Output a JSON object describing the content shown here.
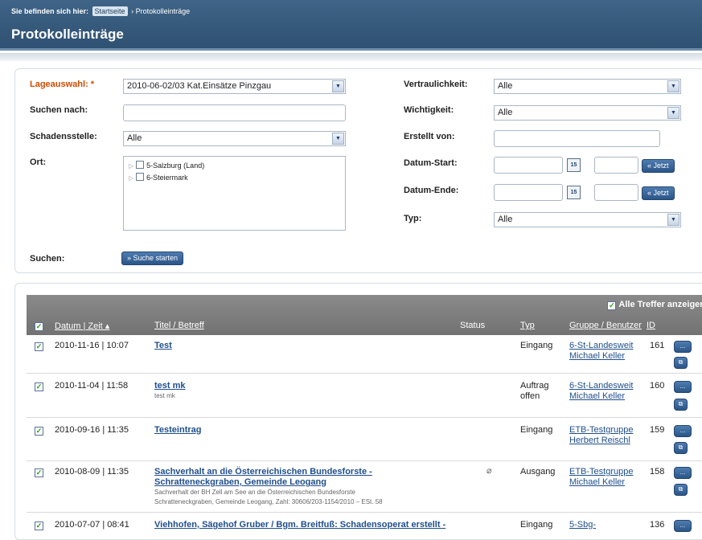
{
  "breadcrumb": {
    "label": "Sie befinden sich hier:",
    "home": "Startseite",
    "current": "› Protokolleinträge"
  },
  "page_title": "Protokolleinträge",
  "search": {
    "lageauswahl_label": "Lageauswahl: *",
    "lageauswahl_value": "2010-06-02/03 Kat.Einsätze Pinzgau",
    "suchen_nach_label": "Suchen nach:",
    "suchen_nach_value": "",
    "schadensstelle_label": "Schadensstelle:",
    "schadensstelle_value": "Alle",
    "ort_label": "Ort:",
    "ort_tree": [
      "5-Salzburg (Land)",
      "6-Steiermark"
    ],
    "vertraulichkeit_label": "Vertraulichkeit:",
    "vertraulichkeit_value": "Alle",
    "wichtigkeit_label": "Wichtigkeit:",
    "wichtigkeit_value": "Alle",
    "erstellt_von_label": "Erstellt von:",
    "erstellt_von_value": "",
    "datum_start_label": "Datum-Start:",
    "datum_ende_label": "Datum-Ende:",
    "jetzt_label": "« Jetzt",
    "calendar_day": "15",
    "typ_label": "Typ:",
    "typ_value": "Alle",
    "suchen_label": "Suchen:",
    "suche_starten": "» Suche starten"
  },
  "results": {
    "all_hits": "Alle Treffer anzeigen",
    "columns": {
      "datum": "Datum | Zeit ▴",
      "titel": "Titel / Betreff",
      "status": "Status",
      "typ": "Typ",
      "gruppe": "Gruppe / Benutzer",
      "id": "ID"
    },
    "button_more": "...",
    "rows": [
      {
        "datum": "2010-11-16 | 10:07",
        "title": "Test",
        "title2": "",
        "sub1": "",
        "sub2": "",
        "typ": "Eingang",
        "typ2": "",
        "gruppe": "6-St-Landesweit",
        "benutzer": "Michael Keller",
        "id": "161"
      },
      {
        "datum": "2010-11-04 | 11:58",
        "title": "test mk",
        "title2": "",
        "sub1": "test mk",
        "sub2": "",
        "typ": "Auftrag",
        "typ2": "offen",
        "gruppe": "6-St-Landesweit",
        "benutzer": "Michael Keller",
        "id": "160"
      },
      {
        "datum": "2010-09-16 | 11:35",
        "title": "Testeintrag",
        "title2": "",
        "sub1": "",
        "sub2": "",
        "typ": "Eingang",
        "typ2": "",
        "gruppe": "ETB-Testgruppe",
        "benutzer": "Herbert Reischl",
        "id": "159"
      },
      {
        "datum": "2010-08-09 | 11:35",
        "title": "Sachverhalt an die Österreichischen Bundesforste -",
        "title2": "Schratteneckgraben, Gemeinde Leogang",
        "sub1": "Sachverhalt der BH Zell am See an die Österreichischen Bundesforste",
        "sub2": "Schratteneckgraben, Gemeinde Leogang, Zahl: 30606/203-1154/2010 – ESt. 58",
        "typ": "Ausgang",
        "typ2": "",
        "gruppe": "ETB-Testgruppe",
        "benutzer": "Michael Keller",
        "id": "158"
      },
      {
        "datum": "2010-07-07 | 08:41",
        "title": "Viehhofen, Sägehof Gruber / Bgm. Breitfuß: Schadensoperat erstellt -",
        "title2": "",
        "sub1": "",
        "sub2": "",
        "typ": "Eingang",
        "typ2": "",
        "gruppe": "5-Sbg-",
        "benutzer": "",
        "id": "136"
      }
    ]
  }
}
